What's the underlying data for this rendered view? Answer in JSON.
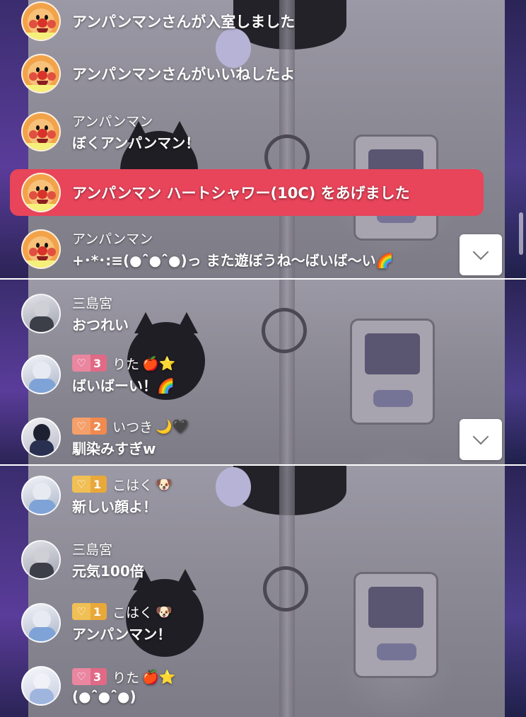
{
  "panel1": {
    "comments": [
      {
        "type": "system",
        "text": "アンパンマンさんが入室しました"
      },
      {
        "type": "system",
        "text": "アンパンマンさんがいいねしたよ"
      },
      {
        "type": "chat",
        "name": "アンパンマン",
        "message": "ぼくアンパンマン！"
      },
      {
        "type": "gift",
        "text": "アンパンマン ハートシャワー(10C) をあげました"
      },
      {
        "type": "chat",
        "name": "アンパンマン",
        "message": "+･*･:≡(●ˆ̑●ˆ̑●)っ また遊ぼうね〜ばいば〜い🌈"
      }
    ]
  },
  "panel2": {
    "comments": [
      {
        "name": "三島宮",
        "message": "おつれい"
      },
      {
        "badge_level": "3",
        "name": "りた",
        "name_emoji": "🍎⭐",
        "message": "ばいばーい！🌈"
      },
      {
        "badge_level": "2",
        "name": "いつき",
        "name_emoji": "🌙🖤",
        "message": "馴染みすぎw"
      }
    ]
  },
  "panel3": {
    "comments": [
      {
        "badge_level": "1",
        "name": "こはく",
        "name_emoji": "🐶",
        "message": "新しい顔よ！"
      },
      {
        "name": "三島宮",
        "message": "元気100倍"
      },
      {
        "badge_level": "1",
        "name": "こはく",
        "name_emoji": "🐶",
        "message": "アンパンマン！"
      },
      {
        "badge_level": "3",
        "name": "りた",
        "name_emoji": "🍎⭐",
        "message": "(●ˆ̑●ˆ̑●)"
      }
    ]
  },
  "icons": {
    "badge_heart": "heart-icon",
    "scroll_down": "chevron-down-icon"
  },
  "colors": {
    "gift_bar": "#e8445a",
    "badge_level_3": "#e06a86",
    "badge_level_2": "#f08a4e",
    "badge_level_1": "#e8a83a"
  }
}
